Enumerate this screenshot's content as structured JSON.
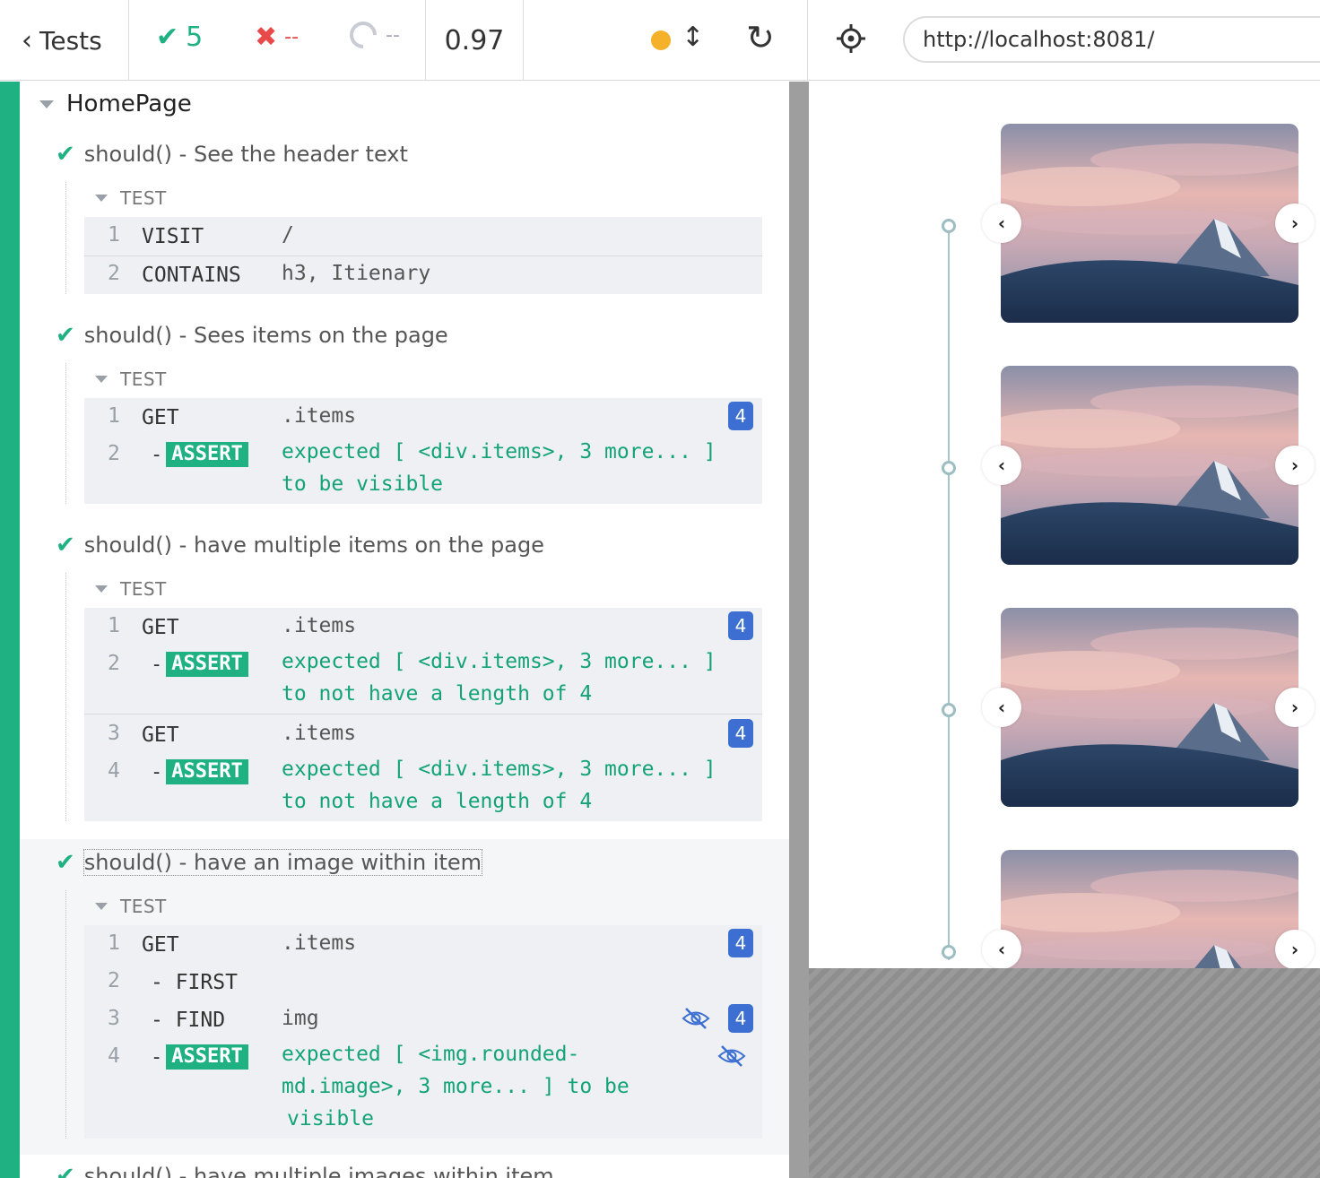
{
  "header": {
    "back_label": "Tests",
    "passed": "5",
    "failed": "--",
    "pending": "--",
    "duration": "0.97",
    "url": "http://localhost:8081/"
  },
  "suite": {
    "title": "HomePage",
    "tests": [
      {
        "title": "should() - See the header text",
        "section": "TEST",
        "commands": [
          {
            "num": "1",
            "name": "VISIT",
            "message": "/"
          },
          {
            "num": "2",
            "name": "CONTAINS",
            "message": "h3, Itienary"
          }
        ]
      },
      {
        "title": "should() - Sees items on the page",
        "section": "TEST",
        "commands": [
          {
            "num": "1",
            "name": "GET",
            "message": ".items",
            "count": "4"
          },
          {
            "num": "2",
            "name": "ASSERT",
            "dash": "-",
            "message_line1": "expected [ <div.items>, 3 more... ]",
            "message_line2": "to be  visible"
          }
        ]
      },
      {
        "title": "should() - have multiple items on the page",
        "section": "TEST",
        "commands": [
          {
            "num": "1",
            "name": "GET",
            "message": ".items",
            "count": "4"
          },
          {
            "num": "2",
            "name": "ASSERT",
            "dash": "-",
            "message_line1": "expected [ <div.items>, 3 more... ]",
            "message_line2": "to not have a length of  4"
          },
          {
            "num": "3",
            "name": "GET",
            "message": ".items",
            "count": "4"
          },
          {
            "num": "4",
            "name": "ASSERT",
            "dash": "-",
            "message_line1": "expected [ <div.items>, 3 more... ]",
            "message_line2": "to not have a length of  4"
          }
        ]
      },
      {
        "title": "should() - have an image within item",
        "section": "TEST",
        "commands": [
          {
            "num": "1",
            "name": "GET",
            "message": ".items",
            "count": "4"
          },
          {
            "num": "2",
            "name": "- FIRST"
          },
          {
            "num": "3",
            "name": "- FIND",
            "message": "img",
            "count": "4",
            "icon": "eye-slash-icon"
          },
          {
            "num": "4",
            "name": "ASSERT",
            "dash": "-",
            "message_line1": "expected [ <img.rounded-",
            "message_line2": "md.image>, 3 more... ]  to be",
            "message_line3": "visible",
            "icon": "eye-slash-icon"
          }
        ]
      },
      {
        "title": "should() - have multiple images within item"
      }
    ]
  },
  "preview": {
    "cards": [
      {
        "prev": "‹",
        "next": "›"
      },
      {
        "prev": "‹",
        "next": "›"
      },
      {
        "prev": "‹",
        "next": "›"
      },
      {
        "prev": "‹",
        "next": "›"
      }
    ]
  },
  "colors": {
    "pass": "#1fb181",
    "fail": "#e84a4a",
    "badge": "#3c6fd1",
    "running": "#f6b12a"
  }
}
